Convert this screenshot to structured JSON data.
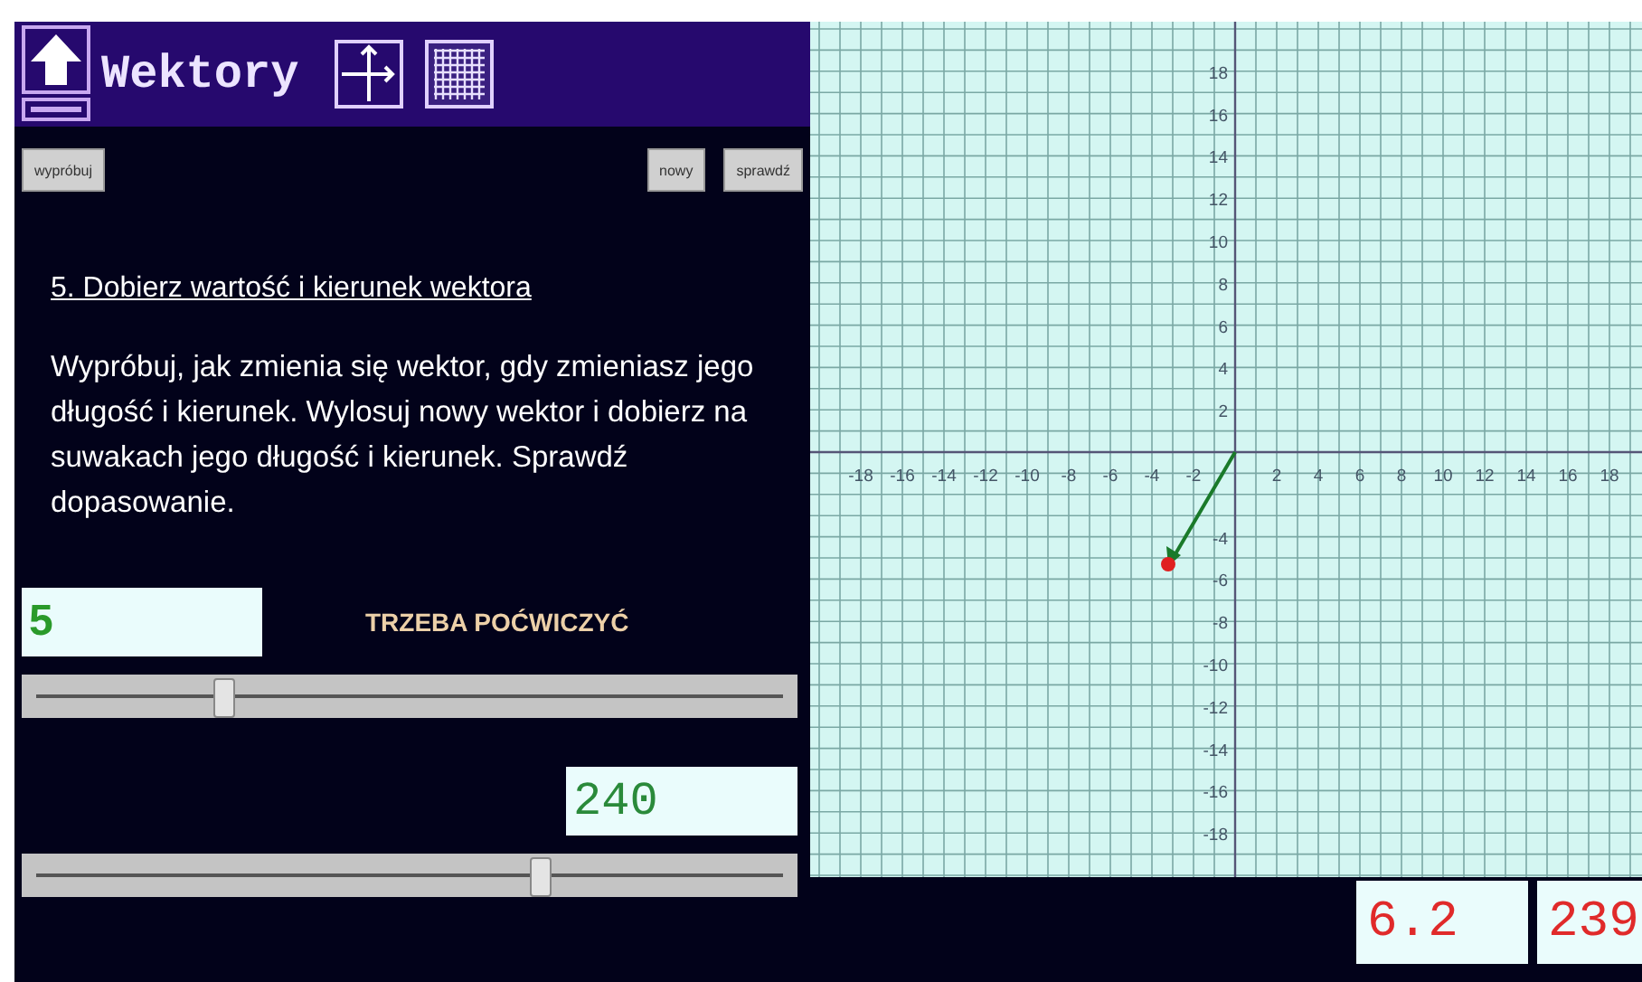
{
  "header": {
    "title": "Wektory"
  },
  "buttons": [
    {
      "label": "wypróbuj"
    },
    {
      "label": "nowy"
    },
    {
      "label": "sprawdź"
    }
  ],
  "task": {
    "heading": "5. Dobierz wartość i kierunek wektora",
    "text": "Wypróbuj, jak zmienia się wektor, gdy zmieniasz jego długość i kierunek. Wylosuj nowy wektor i dobierz na suwakach jego długość i kierunek. Sprawdź dopasowanie."
  },
  "length_field": {
    "value": "5"
  },
  "feedback": "TRZEBA POĆWICZYĆ",
  "length_slider": {
    "level": 0.26
  },
  "direction_field": {
    "value": "240"
  },
  "direction_slider": {
    "level": 0.67
  },
  "plane": {
    "x_labels": [
      "-18",
      "-16",
      "-14",
      "-12",
      "-10",
      "-8",
      "-6",
      "-4",
      "-2",
      "2",
      "4",
      "6",
      "8",
      "10",
      "12",
      "14",
      "16",
      "18"
    ],
    "y_labels": [
      "18",
      "16",
      "14",
      "12",
      "10",
      "8",
      "6",
      "4",
      "2",
      "-4",
      "-6",
      "-8",
      "-10",
      "-12",
      "-14",
      "-16",
      "-18"
    ]
  },
  "target": {
    "length": "6.2",
    "direction": "239"
  }
}
